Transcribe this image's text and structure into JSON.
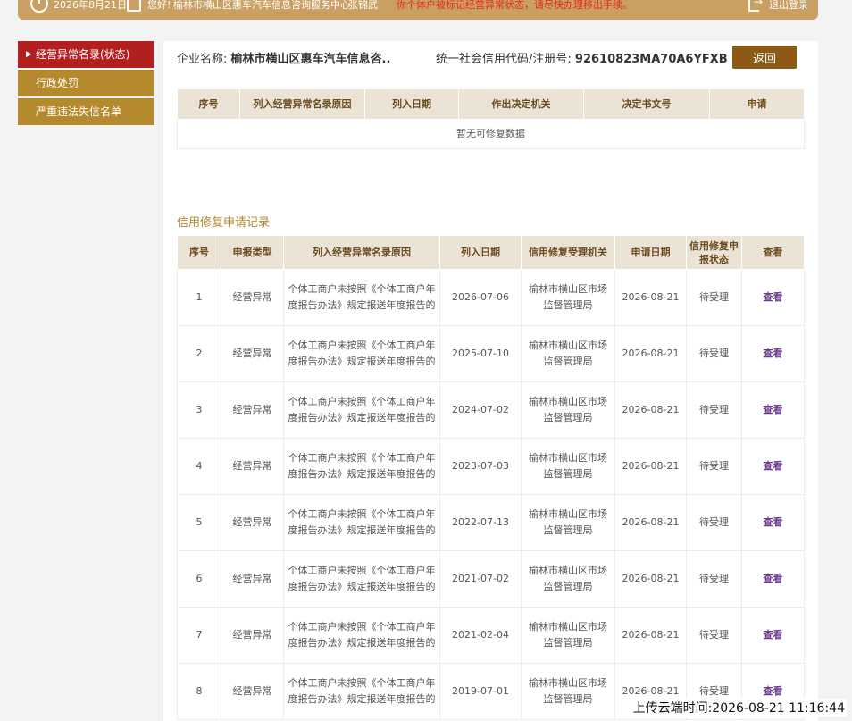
{
  "topbar": {
    "date": "2026年8月21日",
    "greeting": "您好!",
    "org": "榆林市横山区惠车汽车信息咨询服务中心",
    "user": "张锦武",
    "notice": "你个体户被标记经营异常状态，请尽快办理移出手续。",
    "logout": "退出登录"
  },
  "sidebar": {
    "items": [
      {
        "label": "经营异常名录(状态)"
      },
      {
        "label": "行政处罚"
      },
      {
        "label": "严重违法失信名单"
      }
    ]
  },
  "company": {
    "name_label": "企业名称:",
    "name": "榆林市横山区惠车汽车信息咨..",
    "code_label": "统一社会信用代码/注册号:",
    "code": "92610823MA70A6YFXB",
    "back": "返回"
  },
  "table1": {
    "headers": [
      "序号",
      "列入经营异常名录原因",
      "列入日期",
      "作出决定机关",
      "决定书文号",
      "申请"
    ],
    "empty": "暂无可修复数据"
  },
  "records": {
    "title": "信用修复申请记录",
    "headers": [
      "序号",
      "申报类型",
      "列入经营异常名录原因",
      "列入日期",
      "信用修复受理机关",
      "申请日期",
      "信用修复申报状态",
      "查看"
    ],
    "rows": [
      [
        "1",
        "经营异常",
        "个体工商户未按照《个体工商户年度报告办法》规定报送年度报告的",
        "2026-07-06",
        "榆林市横山区市场监督管理局",
        "2026-08-21",
        "待受理",
        "查看"
      ],
      [
        "2",
        "经营异常",
        "个体工商户未按照《个体工商户年度报告办法》规定报送年度报告的",
        "2025-07-10",
        "榆林市横山区市场监督管理局",
        "2026-08-21",
        "待受理",
        "查看"
      ],
      [
        "3",
        "经营异常",
        "个体工商户未按照《个体工商户年度报告办法》规定报送年度报告的",
        "2024-07-02",
        "榆林市横山区市场监督管理局",
        "2026-08-21",
        "待受理",
        "查看"
      ],
      [
        "4",
        "经营异常",
        "个体工商户未按照《个体工商户年度报告办法》规定报送年度报告的",
        "2023-07-03",
        "榆林市横山区市场监督管理局",
        "2026-08-21",
        "待受理",
        "查看"
      ],
      [
        "5",
        "经营异常",
        "个体工商户未按照《个体工商户年度报告办法》规定报送年度报告的",
        "2022-07-13",
        "榆林市横山区市场监督管理局",
        "2026-08-21",
        "待受理",
        "查看"
      ],
      [
        "6",
        "经营异常",
        "个体工商户未按照《个体工商户年度报告办法》规定报送年度报告的",
        "2021-07-02",
        "榆林市横山区市场监督管理局",
        "2026-08-21",
        "待受理",
        "查看"
      ],
      [
        "7",
        "经营异常",
        "个体工商户未按照《个体工商户年度报告办法》规定报送年度报告的",
        "2021-02-04",
        "榆林市横山区市场监督管理局",
        "2026-08-21",
        "待受理",
        "查看"
      ],
      [
        "8",
        "经营异常",
        "个体工商户未按照《个体工商户年度报告办法》规定报送年度报告的",
        "2019-07-01",
        "榆林市横山区市场监督管理局",
        "2026-08-21",
        "待受理",
        "查看"
      ]
    ]
  },
  "upload_stamp": "上传云端时间:2026-08-21 11:16:44",
  "colors": {
    "accent_gold": "#b58a2e",
    "active_red": "#b21f1f",
    "back_brown": "#8b5a16"
  }
}
